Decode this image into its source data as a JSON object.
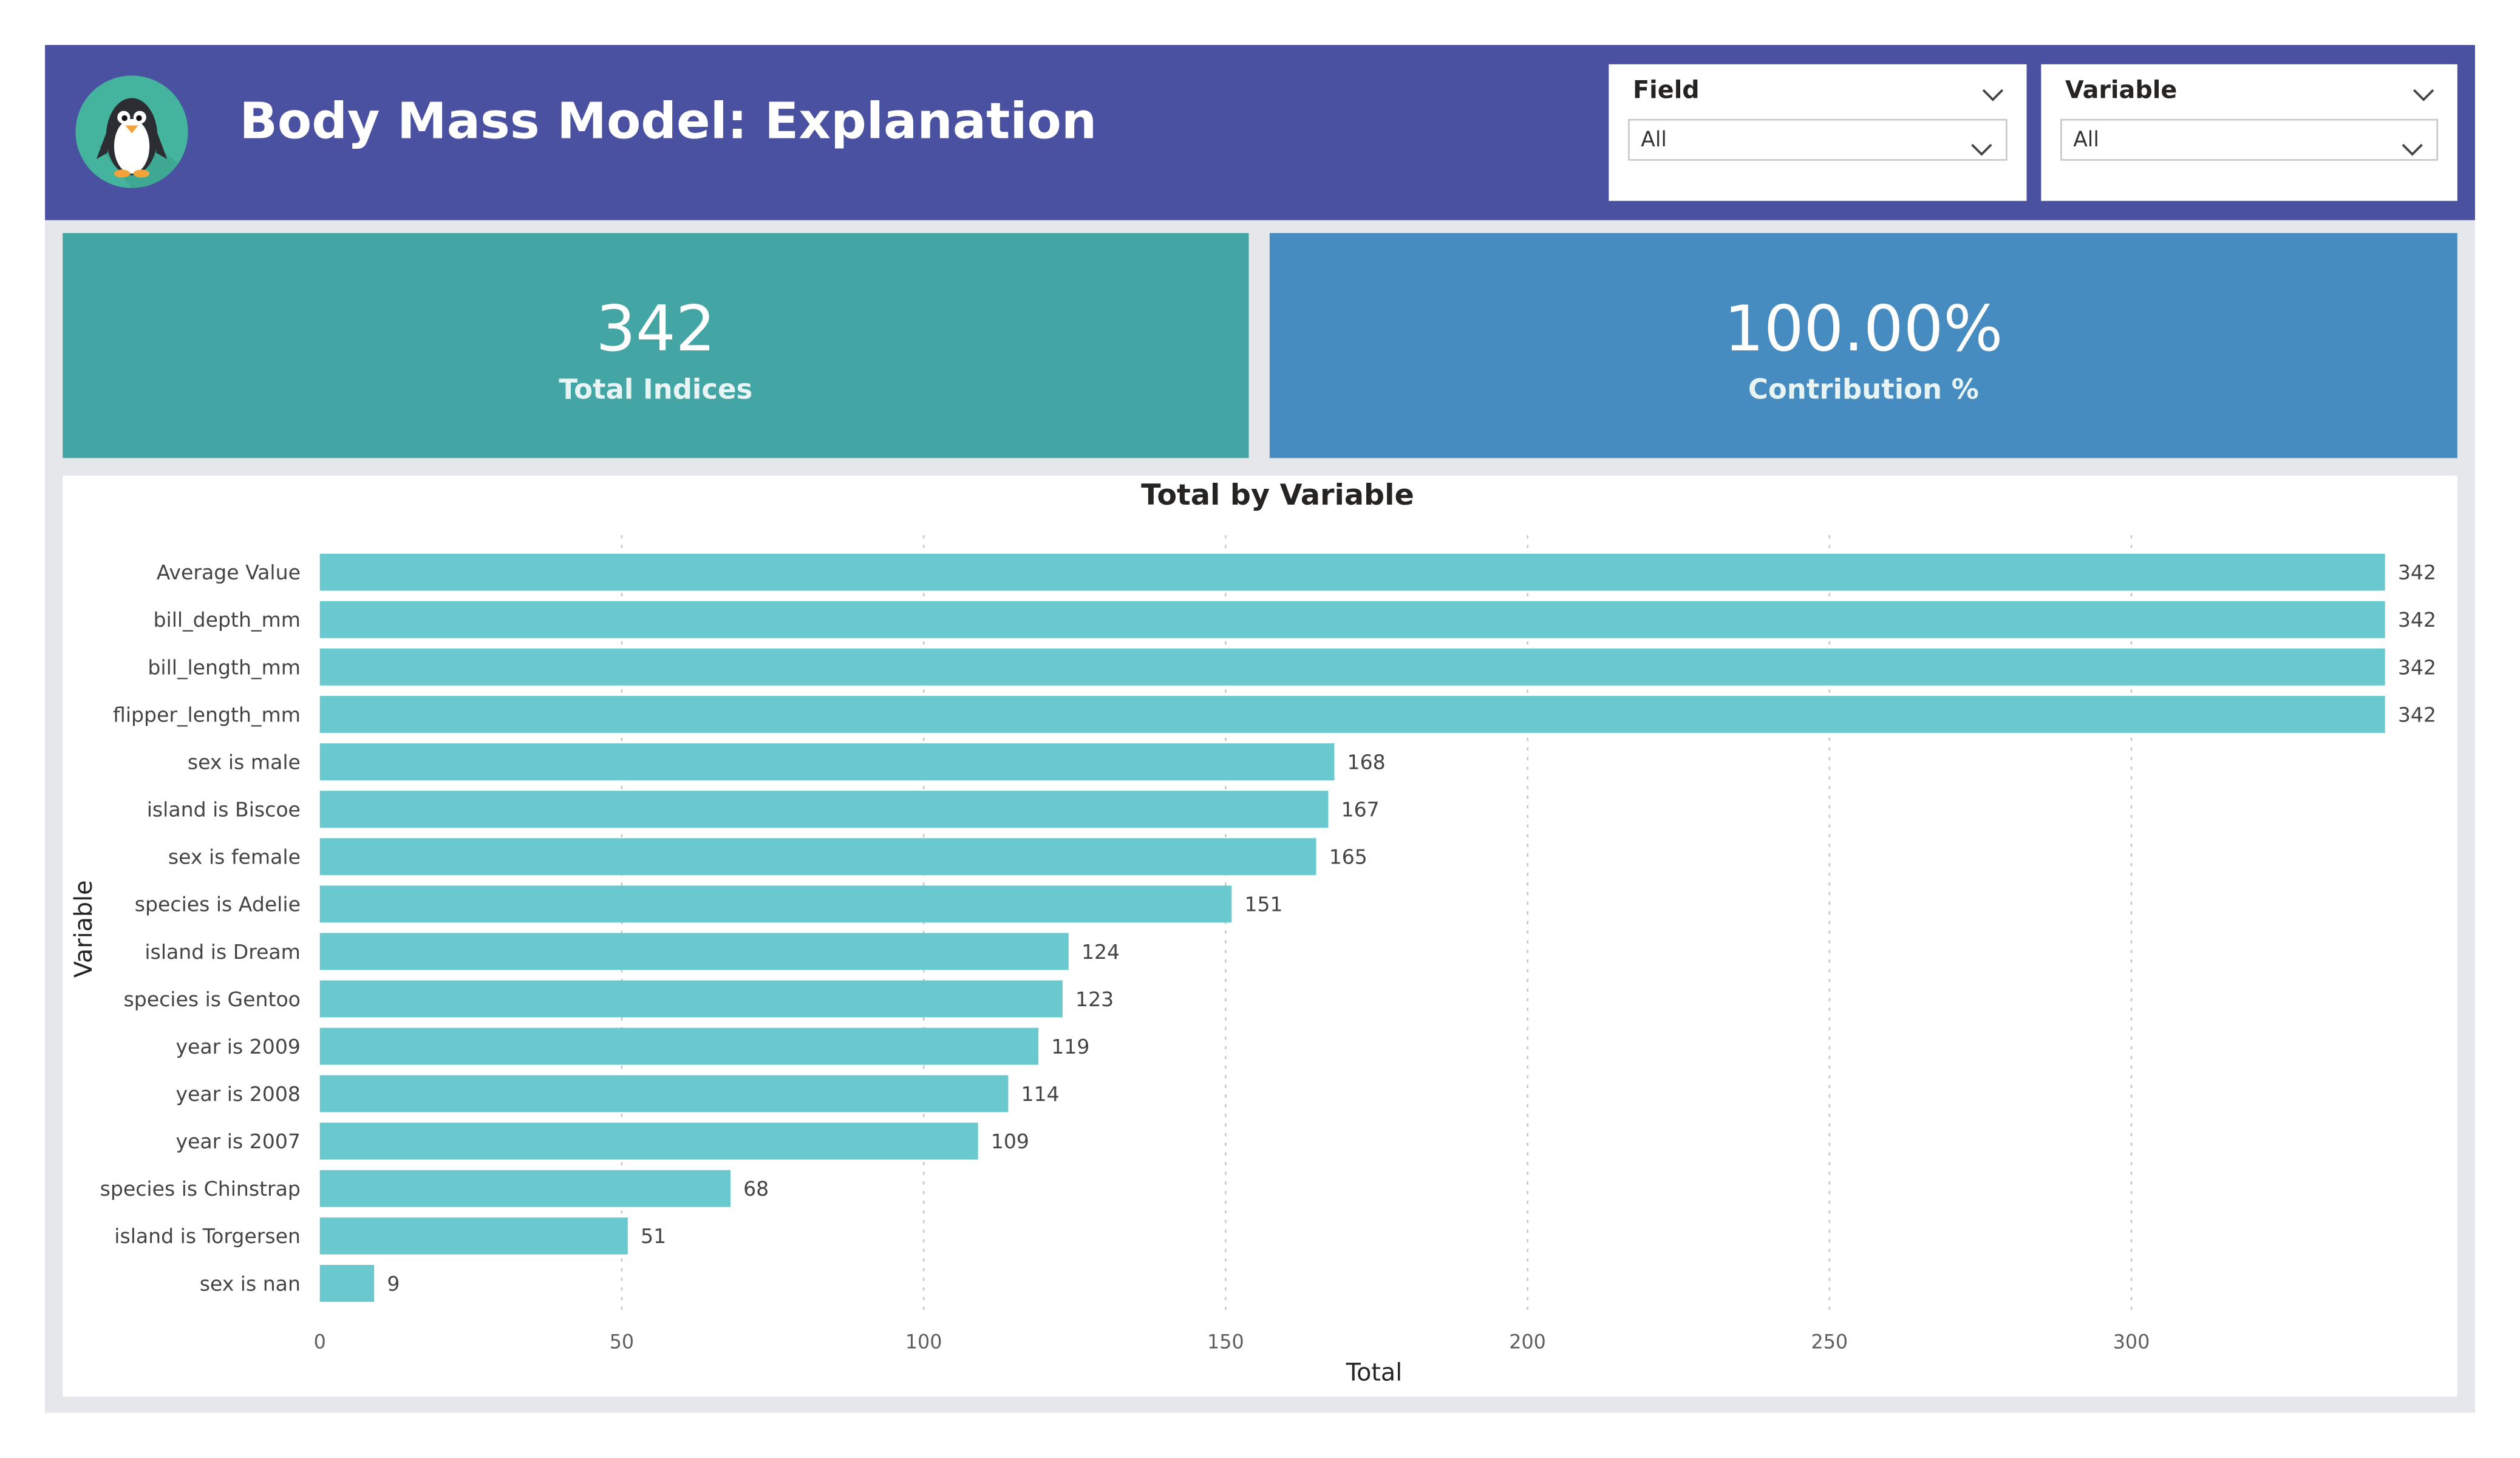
{
  "header": {
    "title": "Body Mass Model: Explanation",
    "logo_icon": "penguin-icon",
    "background_color": "#4a51a0"
  },
  "filters": {
    "field": {
      "label": "Field",
      "value": "All"
    },
    "variable": {
      "label": "Variable",
      "value": "All"
    }
  },
  "cards": {
    "total_indices": {
      "value": "342",
      "label": "Total Indices",
      "color": "#44a6a4"
    },
    "contribution": {
      "value": "100.00%",
      "label": "Contribution %",
      "color": "#468cc0"
    }
  },
  "chart_data": {
    "type": "bar",
    "orientation": "horizontal",
    "title": "Total by Variable",
    "xlabel": "Total",
    "ylabel": "Variable",
    "categories": [
      "Average Value",
      "bill_depth_mm",
      "bill_length_mm",
      "flipper_length_mm",
      "sex is male",
      "island is Biscoe",
      "sex is female",
      "species is Adelie",
      "island is Dream",
      "species is Gentoo",
      "year is 2009",
      "year is 2008",
      "year is 2007",
      "species is Chinstrap",
      "island is Torgersen",
      "sex is nan"
    ],
    "values": [
      342,
      342,
      342,
      342,
      168,
      167,
      165,
      151,
      124,
      123,
      119,
      114,
      109,
      68,
      51,
      9
    ],
    "xlim": [
      0,
      342
    ],
    "xticks": [
      0,
      50,
      100,
      150,
      200,
      250,
      300
    ],
    "grid": true,
    "data_labels": true,
    "bar_color": "#6ac9ce"
  }
}
